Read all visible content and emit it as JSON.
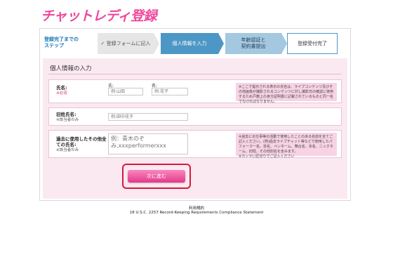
{
  "header": {
    "logo_text": "チャットレディ登録",
    "brand_color": "#f0479a"
  },
  "steps": {
    "title_lines": [
      "登録完了までの",
      "ステップ"
    ],
    "items": [
      {
        "label": "✓ 登録フォームに記入",
        "state": "done"
      },
      {
        "label": "個人情報を入力",
        "state": "active"
      },
      {
        "label": "年齢認証と\n契約書提出",
        "state": "todo"
      },
      {
        "label": "登録受付完了",
        "state": "final"
      }
    ]
  },
  "form": {
    "title": "個人情報の入力",
    "name_row": {
      "label": "氏名:",
      "required": "※必須",
      "last_label": "氏:",
      "last_placeholder": "例:山田",
      "first_label": "名:",
      "first_placeholder": "例:花子",
      "hint": "※ここで提示される表示の氏名は、ライブコンテンツ及びその他画像が撮影されるコンテンツに対し撮影日の確認に使用するため戸籍上の身分証明書に記載されているものと同一名でなければなりません。"
    },
    "old_name_row": {
      "label": "旧姓氏名:",
      "note": "※該当者のみ",
      "placeholder": "例:田中花子"
    },
    "alias_row": {
      "label_lines": [
        "過去に使用したその他全",
        "ての氏名:"
      ],
      "note": "※該当者のみ",
      "placeholder": "例：青木のぞみ,xxxperformerxxx",
      "hint": "※過去にお仕事等の活動で使用したことのある名前を全てご記入ください。(例)過去ライブチャット等などで使用したパフォーマー名、芸名、ペンネーム、舞台名、本名、ニックネーム、旧姓、その他別名を含みます。\n※カンマ(,)区切りでご記入ください"
    },
    "submit_label": "次に進む"
  },
  "footer": {
    "terms_link": "利用規約",
    "statement": "18 U.S.C. 2257 Record-Keeping Requirements Compliance Statement"
  },
  "colors": {
    "accent_blue": "#4d97c6",
    "panel_pink": "#fbe9f1",
    "button_pink": "#e23a8a",
    "highlight_red": "#d6193d"
  }
}
